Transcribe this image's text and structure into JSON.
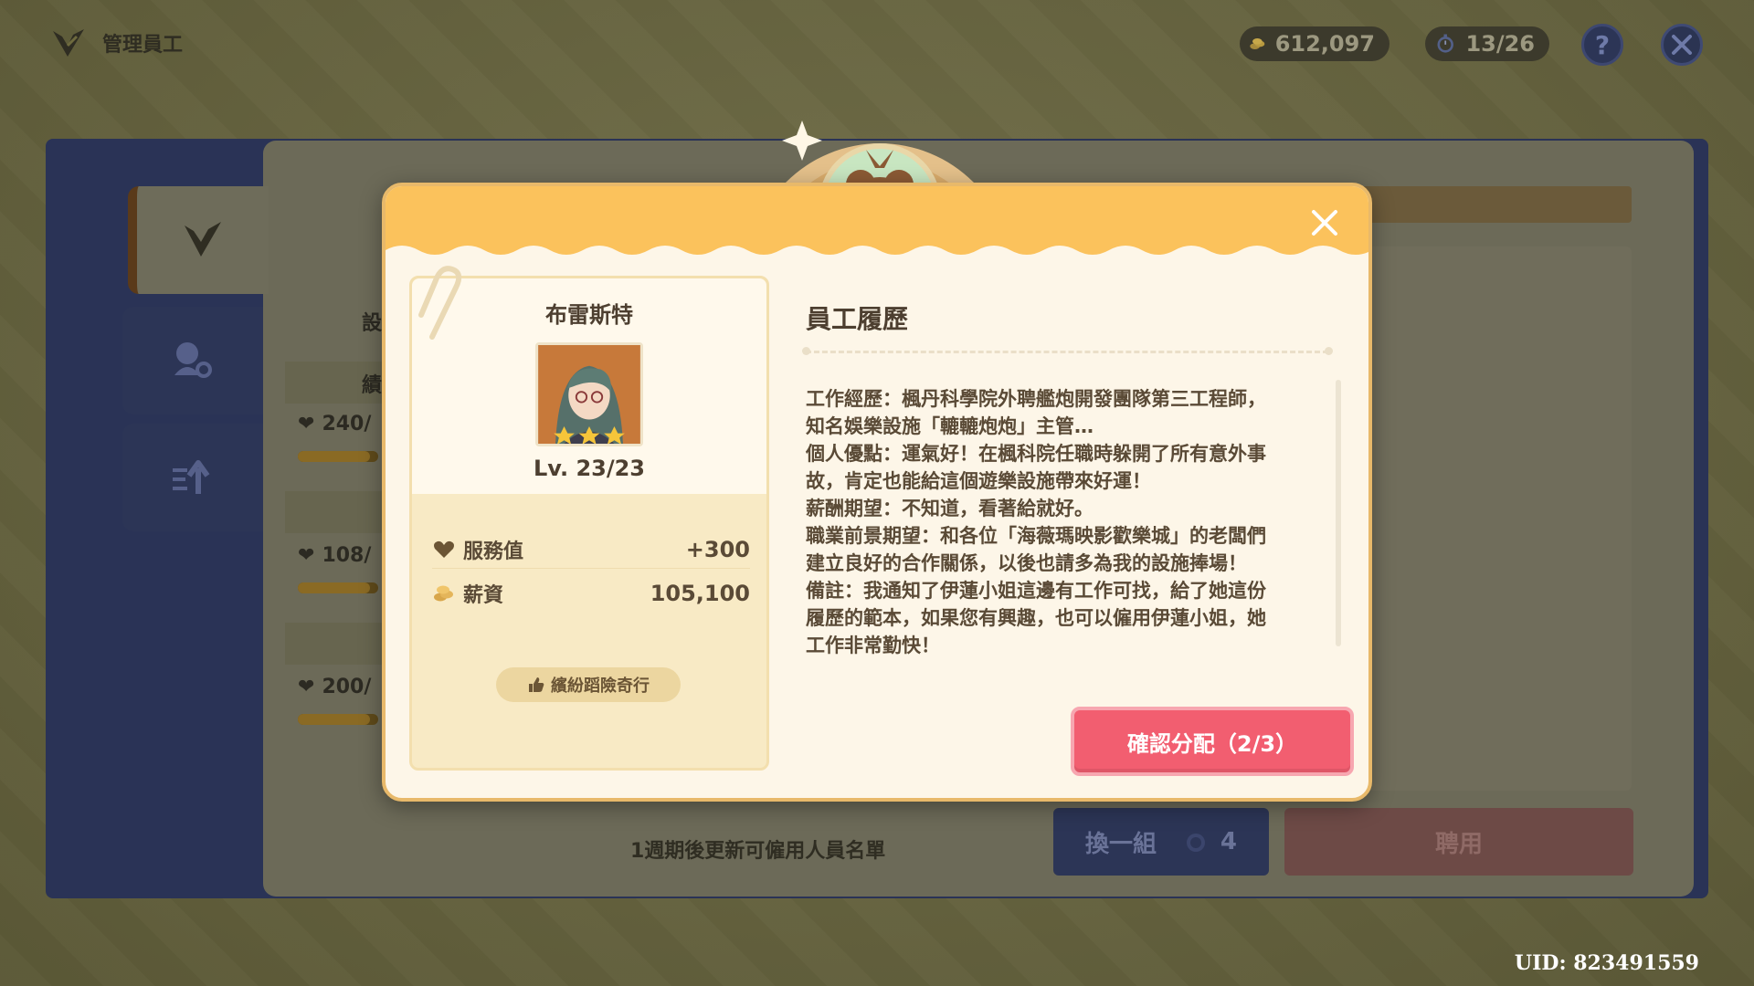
{
  "header": {
    "title": "管理員工",
    "coins": "612,097",
    "timer": "13/26",
    "help_label": "?"
  },
  "background": {
    "stats": [
      "240/",
      "108/",
      "200/"
    ],
    "refresh_note": "1週期後更新可僱用人員名單",
    "swap_label": "換一組",
    "swap_count": "4",
    "hire_label": "聘用",
    "fragments": [
      "設",
      "績"
    ],
    "uid": "UID: 823491559"
  },
  "modal": {
    "employee": {
      "name": "布雷斯特",
      "level_current": "Lv. 23",
      "level_separator": "/",
      "level_max": "23",
      "stars": 3,
      "service_label": "服務值",
      "service_value": "+300",
      "salary_label": "薪資",
      "salary_value": "105,100",
      "skill": "繽紛蹈險奇行"
    },
    "resume_title": "員工履歷",
    "resume_lines": [
      "工作經歷：楓丹科學院外聘艦炮開發團隊第三工程師，",
      "知名娛樂設施「轆轆炮炮」主管…",
      "個人優點：運氣好！在楓科院任職時躲開了所有意外事",
      "故，肯定也能給這個遊樂設施帶來好運！",
      "薪酬期望：不知道，看著給就好。",
      "職業前景期望：和各位「海薇瑪映影歡樂城」的老闆們",
      "建立良好的合作關係，以後也請多為我的設施捧場！",
      "備註：我通知了伊蓮小姐這邊有工作可找，給了她這份",
      "履歷的範本，如果您有興趣，也可以僱用伊蓮小姐，她",
      "工作非常勤快！"
    ],
    "confirm_label": "確認分配（2/3）"
  },
  "colors": {
    "header_gold": "#fbc25c",
    "confirm_pink": "#f25e70",
    "modal_cream": "#fdf6e8",
    "text_brown": "#5a4a36"
  }
}
